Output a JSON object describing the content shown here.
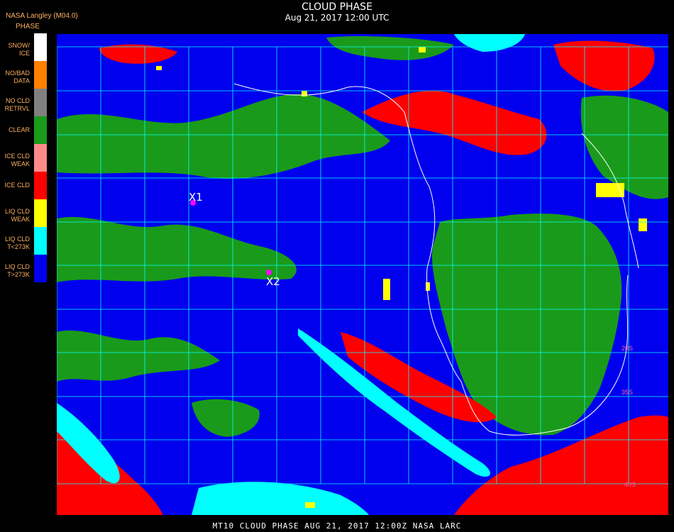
{
  "header": {
    "title": "CLOUD PHASE",
    "datetime": "Aug 21, 2017 12:00 UTC",
    "source": "NASA Langley (M04.0)"
  },
  "legend": {
    "title": "PHASE",
    "items": [
      {
        "label": "SNOW/ ICE",
        "color": "#ffffff"
      },
      {
        "label": "NO/BAD DATA",
        "color": "#ff8000"
      },
      {
        "label": "NO CLD RETRVL",
        "color": "#808080"
      },
      {
        "label": "CLEAR",
        "color": "#1a9a1a"
      },
      {
        "label": "ICE CLD WEAK",
        "color": "#ff8a8a"
      },
      {
        "label": "ICE CLD",
        "color": "#ff0000"
      },
      {
        "label": "LIQ CLD WEAK",
        "color": "#ffff00"
      },
      {
        "label": "LIQ CLD T<273K",
        "color": "#00ffff"
      },
      {
        "label": "LIQ CLD T>273K",
        "color": "#0000ee"
      }
    ]
  },
  "map": {
    "markers": [
      {
        "label": "X1",
        "color": "#ff00ff"
      },
      {
        "label": "X2",
        "color": "#ff00ff"
      }
    ],
    "lat_labels": [
      "20S",
      "35S",
      "40S"
    ],
    "grid_color": "#00ffff"
  },
  "footer": "MT10  CLOUD PHASE  AUG 21, 2017 12:00Z  NASA LARC"
}
